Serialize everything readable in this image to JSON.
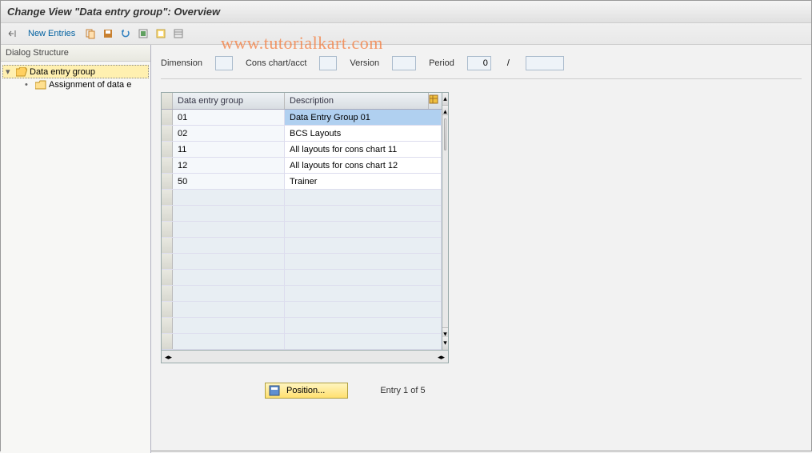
{
  "titlebar": {
    "title": "Change View \"Data entry group\": Overview"
  },
  "toolbar": {
    "new_entries": "New Entries"
  },
  "sidebar": {
    "header": "Dialog Structure",
    "nodes": [
      {
        "label": "Data entry group"
      },
      {
        "label": "Assignment of data e"
      }
    ]
  },
  "filters": {
    "dimension_lbl": "Dimension",
    "cons_lbl": "Cons chart/acct",
    "version_lbl": "Version",
    "period_lbl": "Period",
    "period_val": "0",
    "slash": "/"
  },
  "grid": {
    "col1": "Data entry group",
    "col2": "Description",
    "rows": [
      {
        "code": "01",
        "desc": "Data Entry Group 01",
        "selected": true
      },
      {
        "code": "02",
        "desc": "BCS Layouts"
      },
      {
        "code": "11",
        "desc": "All layouts for cons chart 11"
      },
      {
        "code": "12",
        "desc": "All layouts for cons chart 12"
      },
      {
        "code": "50",
        "desc": "Trainer"
      }
    ]
  },
  "footer": {
    "position_btn": "Position...",
    "entry_text": "Entry 1 of 5"
  },
  "watermark": "www.tutorialkart.com"
}
